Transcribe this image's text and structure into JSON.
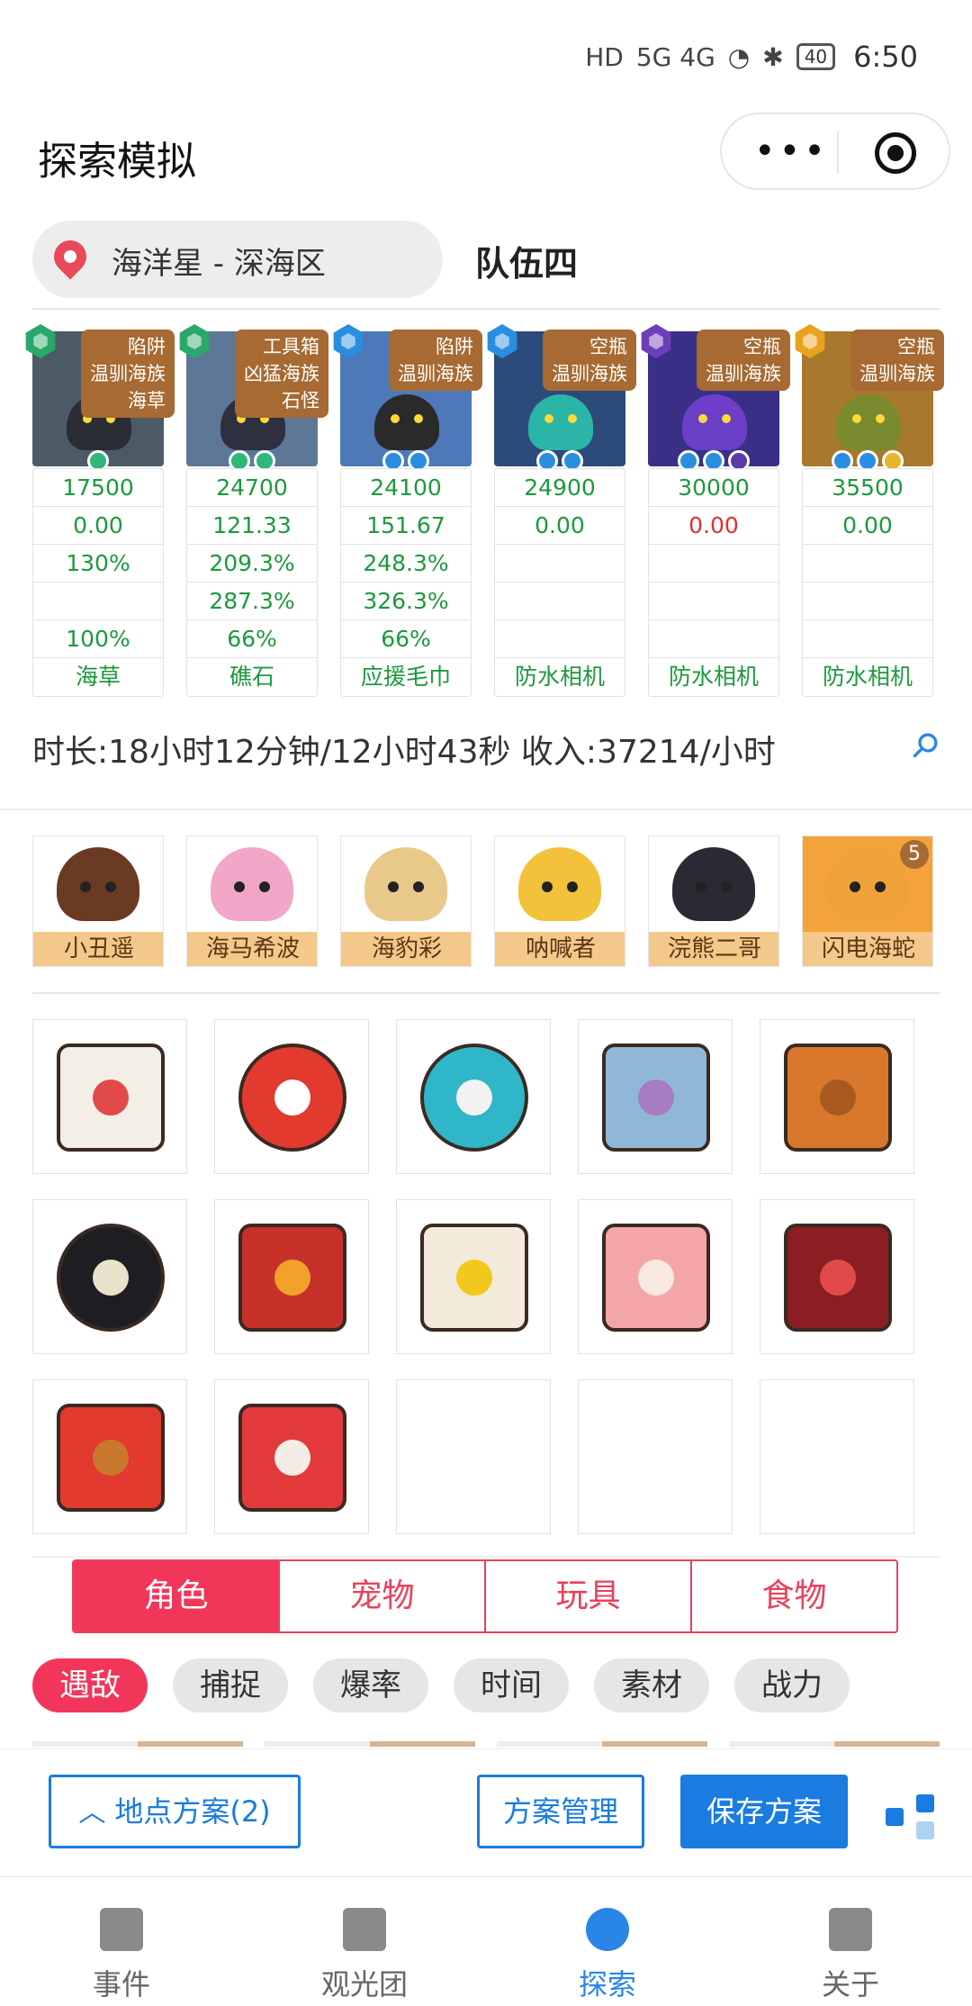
{
  "status_bar": {
    "network": "5G 4G",
    "battery": "40",
    "time": "6:50"
  },
  "header": {
    "title": "探索模拟",
    "menu_icon": "more-dots-icon",
    "close_icon": "target-icon"
  },
  "location": {
    "name": "海洋星 - 深海区",
    "team": "队伍四"
  },
  "monsters": [
    {
      "tag": "陷阱\n温驯海族\n海草",
      "rank_color": "#2aa86a",
      "img_color": "#4c5a66",
      "body_color": "#2b2d35",
      "gem_colors": [
        "#2fb67a"
      ],
      "cells": [
        [
          "17500",
          "g"
        ],
        [
          "0.00",
          "g"
        ],
        [
          "130%",
          "g"
        ],
        [
          "",
          "g"
        ],
        [
          "100%",
          "g"
        ],
        [
          "海草",
          "g"
        ]
      ]
    },
    {
      "tag": "工具箱\n凶猛海族\n石怪",
      "rank_color": "#2aa86a",
      "img_color": "#5c7896",
      "body_color": "#2e3040",
      "gem_colors": [
        "#2fb67a",
        "#2fb67a"
      ],
      "cells": [
        [
          "24700",
          "g"
        ],
        [
          "121.33",
          "g"
        ],
        [
          "209.3%",
          "g"
        ],
        [
          "287.3%",
          "g"
        ],
        [
          "66%",
          "g"
        ],
        [
          "礁石",
          "g"
        ]
      ]
    },
    {
      "tag": "陷阱\n温驯海族",
      "rank_color": "#2a8ee0",
      "img_color": "#4d79b8",
      "body_color": "#2a2a2a",
      "gem_colors": [
        "#2a8ee0",
        "#2a8ee0"
      ],
      "cells": [
        [
          "24100",
          "g"
        ],
        [
          "151.67",
          "g"
        ],
        [
          "248.3%",
          "g"
        ],
        [
          "326.3%",
          "g"
        ],
        [
          "66%",
          "g"
        ],
        [
          "应援毛巾",
          "g"
        ]
      ]
    },
    {
      "tag": "空瓶\n温驯海族",
      "rank_color": "#2a8ee0",
      "img_color": "#2c4b7a",
      "body_color": "#2ab5a8",
      "gem_colors": [
        "#2a8ee0",
        "#2a8ee0"
      ],
      "cells": [
        [
          "24900",
          "g"
        ],
        [
          "0.00",
          "g"
        ],
        [
          "",
          "g"
        ],
        [
          "",
          "g"
        ],
        [
          "",
          "g"
        ],
        [
          "防水相机",
          "g"
        ]
      ]
    },
    {
      "tag": "空瓶\n温驯海族",
      "rank_color": "#6b3fb8",
      "img_color": "#3a2f86",
      "body_color": "#6b3fc8",
      "gem_colors": [
        "#2a8ee0",
        "#2a8ee0",
        "#5b3aa8"
      ],
      "cells": [
        [
          "30000",
          "g"
        ],
        [
          "0.00",
          "r"
        ],
        [
          "",
          "g"
        ],
        [
          "",
          "g"
        ],
        [
          "",
          "g"
        ],
        [
          "防水相机",
          "g"
        ]
      ]
    },
    {
      "tag": "空瓶\n温驯海族",
      "rank_color": "#e8a21e",
      "img_color": "#a8782c",
      "body_color": "#7a8a2e",
      "gem_colors": [
        "#2a8ee0",
        "#2a8ee0",
        "#e8b52a"
      ],
      "cells": [
        [
          "35500",
          "g"
        ],
        [
          "0.00",
          "g"
        ],
        [
          "",
          "g"
        ],
        [
          "",
          "g"
        ],
        [
          "",
          "g"
        ],
        [
          "防水相机",
          "g"
        ]
      ]
    }
  ],
  "summary": {
    "duration_text": "时长:18小时12分钟/12小时43秒 收入:37214/小时",
    "pin_icon": "pin-icon"
  },
  "pets": [
    {
      "name": "小丑遥",
      "color": "#6b3a22",
      "badge": ""
    },
    {
      "name": "海马希波",
      "color": "#f2a6c8",
      "badge": ""
    },
    {
      "name": "海豹彩",
      "color": "#e8c98a",
      "badge": ""
    },
    {
      "name": "呐喊者",
      "color": "#f2c23a",
      "badge": ""
    },
    {
      "name": "浣熊二哥",
      "color": "#2a2a34",
      "badge": ""
    },
    {
      "name": "闪电海蛇",
      "color": "#f0a23a",
      "badge": "5"
    }
  ],
  "items": [
    {
      "name": "letter-envelope-icon",
      "color": "#f4efe6",
      "accent": "#e24a4a"
    },
    {
      "name": "alarm-clock-icon",
      "color": "#e23a2e",
      "accent": "#ffffff"
    },
    {
      "name": "gear-gem-icon",
      "color": "#2fb6c8",
      "accent": "#f2f2f2"
    },
    {
      "name": "spotted-cloth-icon",
      "color": "#8fb8d8",
      "accent": "#a77cc0"
    },
    {
      "name": "brown-cup-icon",
      "color": "#d8782c",
      "accent": "#a85a1e"
    },
    {
      "name": "tire-icon",
      "color": "#1e1e22",
      "accent": "#e8e2c8"
    },
    {
      "name": "food-box-icon",
      "color": "#c8302a",
      "accent": "#f2a22a"
    },
    {
      "name": "clapperboard-icon",
      "color": "#f4eadc",
      "accent": "#f2c81e"
    },
    {
      "name": "mushroom-icon",
      "color": "#f4a6a6",
      "accent": "#f8e8e0"
    },
    {
      "name": "gift-bag-icon",
      "color": "#8a1e22",
      "accent": "#e24a4a"
    },
    {
      "name": "fried-chicken-bucket-icon",
      "color": "#e23a2e",
      "accent": "#c8782c"
    },
    {
      "name": "potion-bottle-icon",
      "color": "#e23a3a",
      "accent": "#f4ece6"
    },
    {
      "name": "",
      "color": "",
      "accent": ""
    },
    {
      "name": "",
      "color": "",
      "accent": ""
    },
    {
      "name": "",
      "color": "",
      "accent": ""
    }
  ],
  "tabs": [
    {
      "label": "角色",
      "active": true
    },
    {
      "label": "宠物",
      "active": false
    },
    {
      "label": "玩具",
      "active": false
    },
    {
      "label": "食物",
      "active": false
    }
  ],
  "filters": [
    {
      "label": "遇敌",
      "active": true
    },
    {
      "label": "捕捉",
      "active": false
    },
    {
      "label": "爆率",
      "active": false
    },
    {
      "label": "时间",
      "active": false
    },
    {
      "label": "素材",
      "active": false
    },
    {
      "label": "战力",
      "active": false
    }
  ],
  "actions": {
    "location_plans": "地点方案(2)",
    "manage_plans": "方案管理",
    "save_plan": "保存方案",
    "share_icon": "share-icon"
  },
  "nav": [
    {
      "label": "事件",
      "icon": "flag-icon",
      "active": false
    },
    {
      "label": "观光团",
      "icon": "edit-icon",
      "active": false
    },
    {
      "label": "探索",
      "icon": "explore-icon",
      "active": true
    },
    {
      "label": "关于",
      "icon": "list-icon",
      "active": false
    }
  ],
  "colors": {
    "accent_pink": "#f2365a",
    "accent_blue": "#1a7be0",
    "green_value": "#1c9a3c",
    "red_value": "#e0302f"
  }
}
